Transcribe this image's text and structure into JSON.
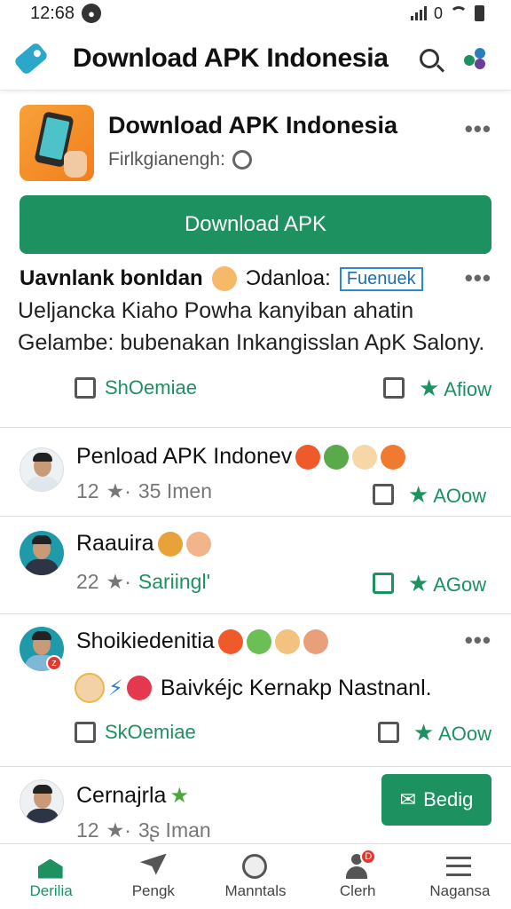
{
  "status_bar": {
    "time": "12:68",
    "right_text": "0"
  },
  "app_bar": {
    "title": "Download APK Indonesia"
  },
  "app_card": {
    "title": "Download APK Indonesia",
    "subtitle": "Firlkgianengh:",
    "download_label": "Download APK"
  },
  "posts": [
    {
      "headline": "Uavnlank bonldan",
      "headline_extra": "Ɔdanloa:",
      "tag": "Fuenuek",
      "body": "Ueljancka Kiaho Powha kanyiban ahatin Gelambe: bubenakan Inkangisslan ApK Salony.",
      "action_left": "ShOemiae",
      "action_right": "Afiow"
    },
    {
      "name": "Penload APK Indonev",
      "meta_count": "12",
      "meta_text": "35 Imen",
      "action_right": "AOow"
    },
    {
      "name": "Raauira",
      "meta_count": "22",
      "meta_text": "Sariingl'",
      "action_right": "AGow"
    },
    {
      "name": "Shoikiedenitia",
      "body": "Baivkéjc Kernakp Nastnanl.",
      "badge": "z",
      "action_left": "SkOemiae",
      "action_right": "AOow"
    },
    {
      "name": "Cernajrla",
      "meta_count": "12",
      "meta_text": "3ʂ Iman",
      "button_label": "Bedig"
    }
  ],
  "bottom_nav": [
    {
      "label": "Derilia",
      "icon": "home-icon",
      "active": true
    },
    {
      "label": "Pengk",
      "icon": "send-icon",
      "active": false
    },
    {
      "label": "Manntals",
      "icon": "globe-icon",
      "active": false
    },
    {
      "label": "Clerh",
      "icon": "person-icon",
      "badge": "D",
      "active": false
    },
    {
      "label": "Nagansa",
      "icon": "menu-icon",
      "active": false
    }
  ],
  "colors": {
    "accent": "#1d9160",
    "title": "#111111",
    "muted": "#777777"
  }
}
